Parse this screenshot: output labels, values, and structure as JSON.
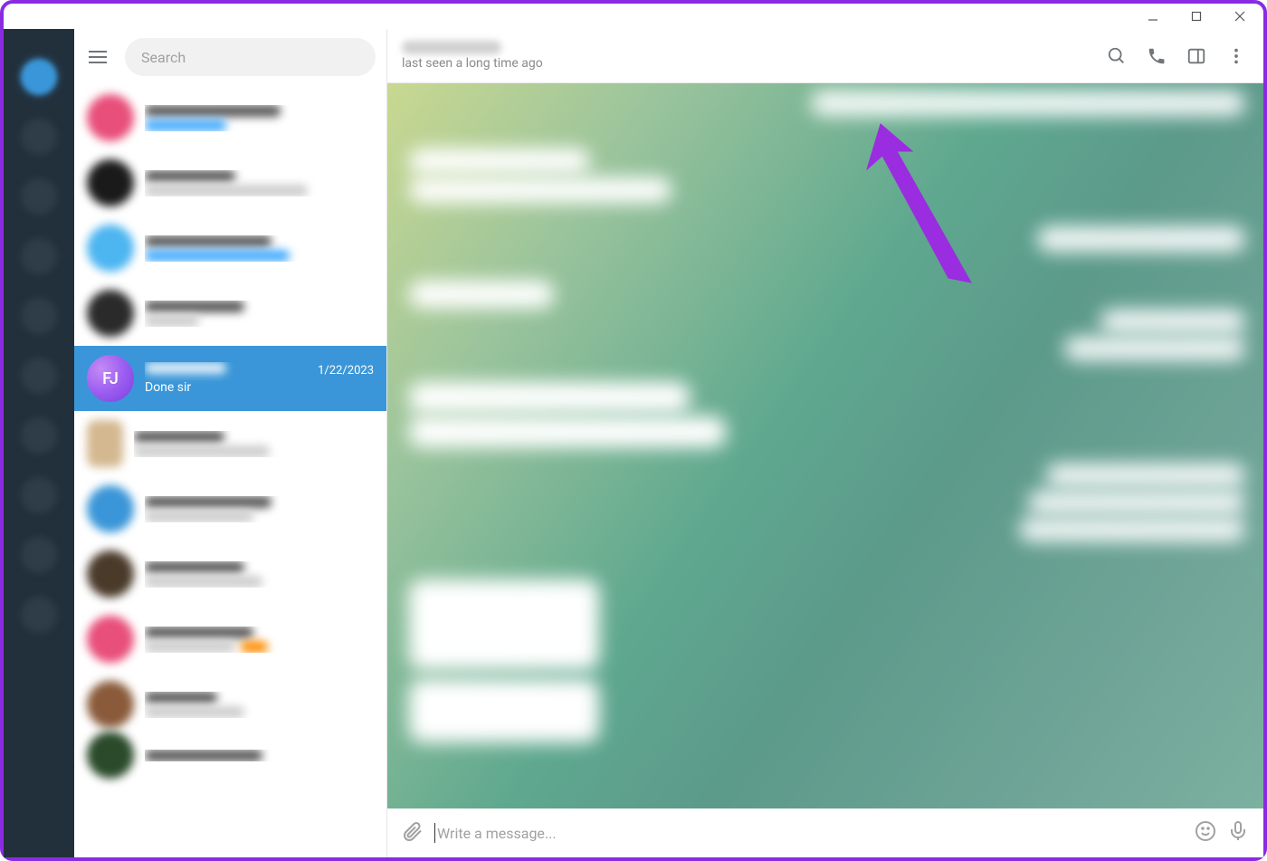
{
  "window": {
    "minimize_title": "Minimize",
    "maximize_title": "Maximize",
    "close_title": "Close"
  },
  "search": {
    "placeholder": "Search"
  },
  "chat_list": {
    "selected": {
      "avatar_initials": "FJ",
      "date": "1/22/2023",
      "preview": "Done sir"
    }
  },
  "chat_header": {
    "status": "last seen a long time ago"
  },
  "message_input": {
    "placeholder": "Write a message..."
  },
  "colors": {
    "accent": "#3a96d8",
    "annotation": "#8a2be2"
  }
}
